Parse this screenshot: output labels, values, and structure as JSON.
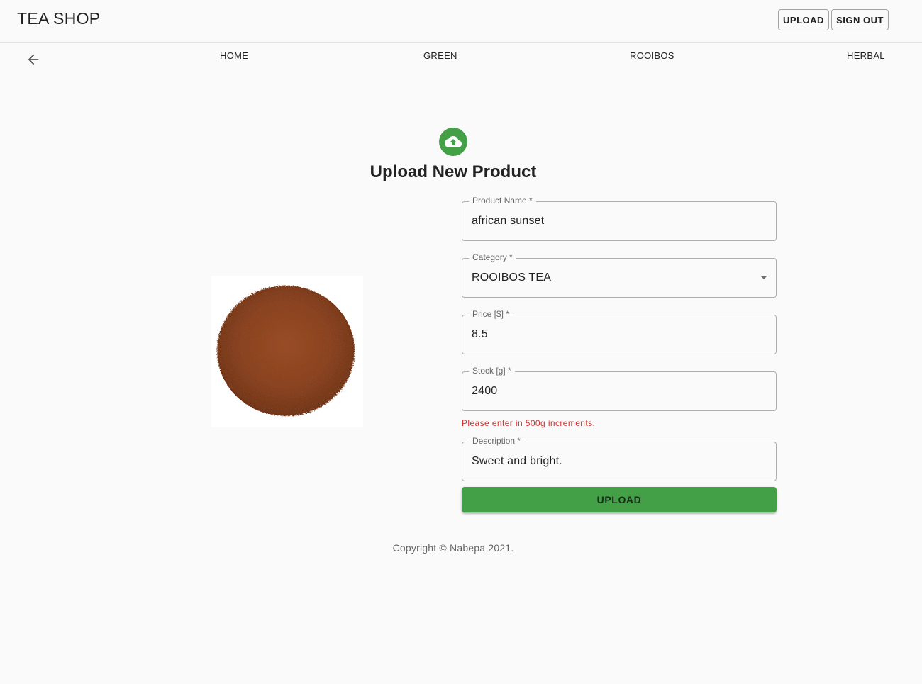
{
  "header": {
    "brand": "TEA SHOP",
    "upload_label": "UPLOAD",
    "signout_label": "SIGN OUT"
  },
  "nav": {
    "back_icon": "arrow-back-icon",
    "links": [
      "HOME",
      "GREEN",
      "ROOIBOS",
      "HERBAL"
    ]
  },
  "main": {
    "icon": "cloud-upload-icon",
    "title": "Upload New Product",
    "image_alt": "rooibos tea leaves",
    "form": {
      "product_name": {
        "label": "Product Name *",
        "value": "african sunset"
      },
      "category": {
        "label": "Category *",
        "value": "ROOIBOS TEA"
      },
      "price": {
        "label": "Price [$] *",
        "value": "8.5"
      },
      "stock": {
        "label": "Stock [g] *",
        "value": "2400",
        "error": "Please enter in 500g increments."
      },
      "description": {
        "label": "Description *",
        "value": "Sweet and bright."
      },
      "submit_label": "UPLOAD"
    }
  },
  "footer": {
    "copyright": "Copyright © Nabepa 2021."
  },
  "colors": {
    "accent": "#43a047",
    "error": "#d32f2f",
    "background": "#fafafa"
  }
}
